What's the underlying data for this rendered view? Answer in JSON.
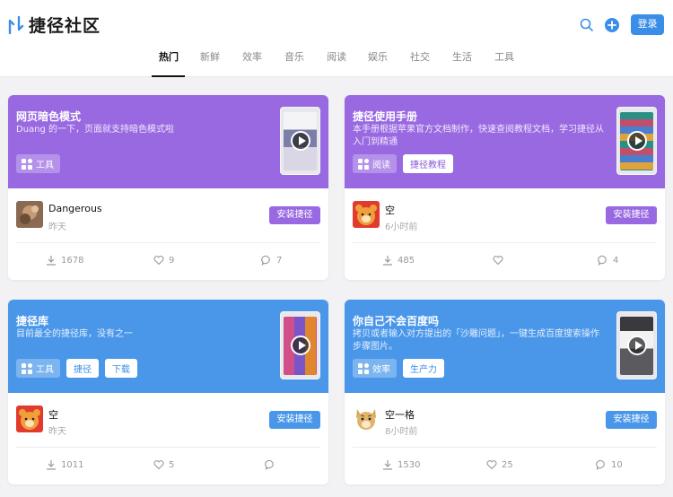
{
  "header": {
    "logo_text": "捷径社区",
    "login_label": "登录",
    "accent": "#3b8ee8"
  },
  "tabs": [
    "热门",
    "新鲜",
    "效率",
    "音乐",
    "阅读",
    "娱乐",
    "社交",
    "生活",
    "工具"
  ],
  "active_tab": "热门",
  "colors": {
    "purple": "#9969e2",
    "blue": "#4a97ea"
  },
  "cards": [
    {
      "title": "网页暗色模式",
      "desc": "Duang 的一下，页面就支持暗色模式啦",
      "category": "工具",
      "extra_tags": [],
      "author": "Dangerous",
      "time": "昨天",
      "install_label": "安装捷径",
      "downloads": "1678",
      "likes": "9",
      "comments": "7",
      "color": "purple"
    },
    {
      "title": "捷径使用手册",
      "desc": "本手册根据苹果官方文档制作，快速查阅教程文档，学习捷径从入门到精通",
      "category": "阅读",
      "extra_tags": [
        "捷径教程"
      ],
      "author": "空",
      "time": "6小时前",
      "install_label": "安装捷径",
      "downloads": "485",
      "likes": "",
      "comments": "4",
      "color": "purple"
    },
    {
      "title": "捷径库",
      "desc": "目前最全的捷径库，没有之一",
      "category": "工具",
      "extra_tags": [
        "捷径",
        "下载"
      ],
      "author": "空",
      "time": "昨天",
      "install_label": "安装捷径",
      "downloads": "1011",
      "likes": "5",
      "comments": "",
      "color": "blue"
    },
    {
      "title": "你自己不会百度吗",
      "desc": "拷贝或者输入对方提出的「沙雕问题」，一键生成百度搜索操作步骤图片。",
      "category": "效率",
      "extra_tags": [
        "生产力"
      ],
      "author": "空一格",
      "time": "8小时前",
      "install_label": "安装捷径",
      "downloads": "1530",
      "likes": "25",
      "comments": "10",
      "color": "blue"
    }
  ]
}
